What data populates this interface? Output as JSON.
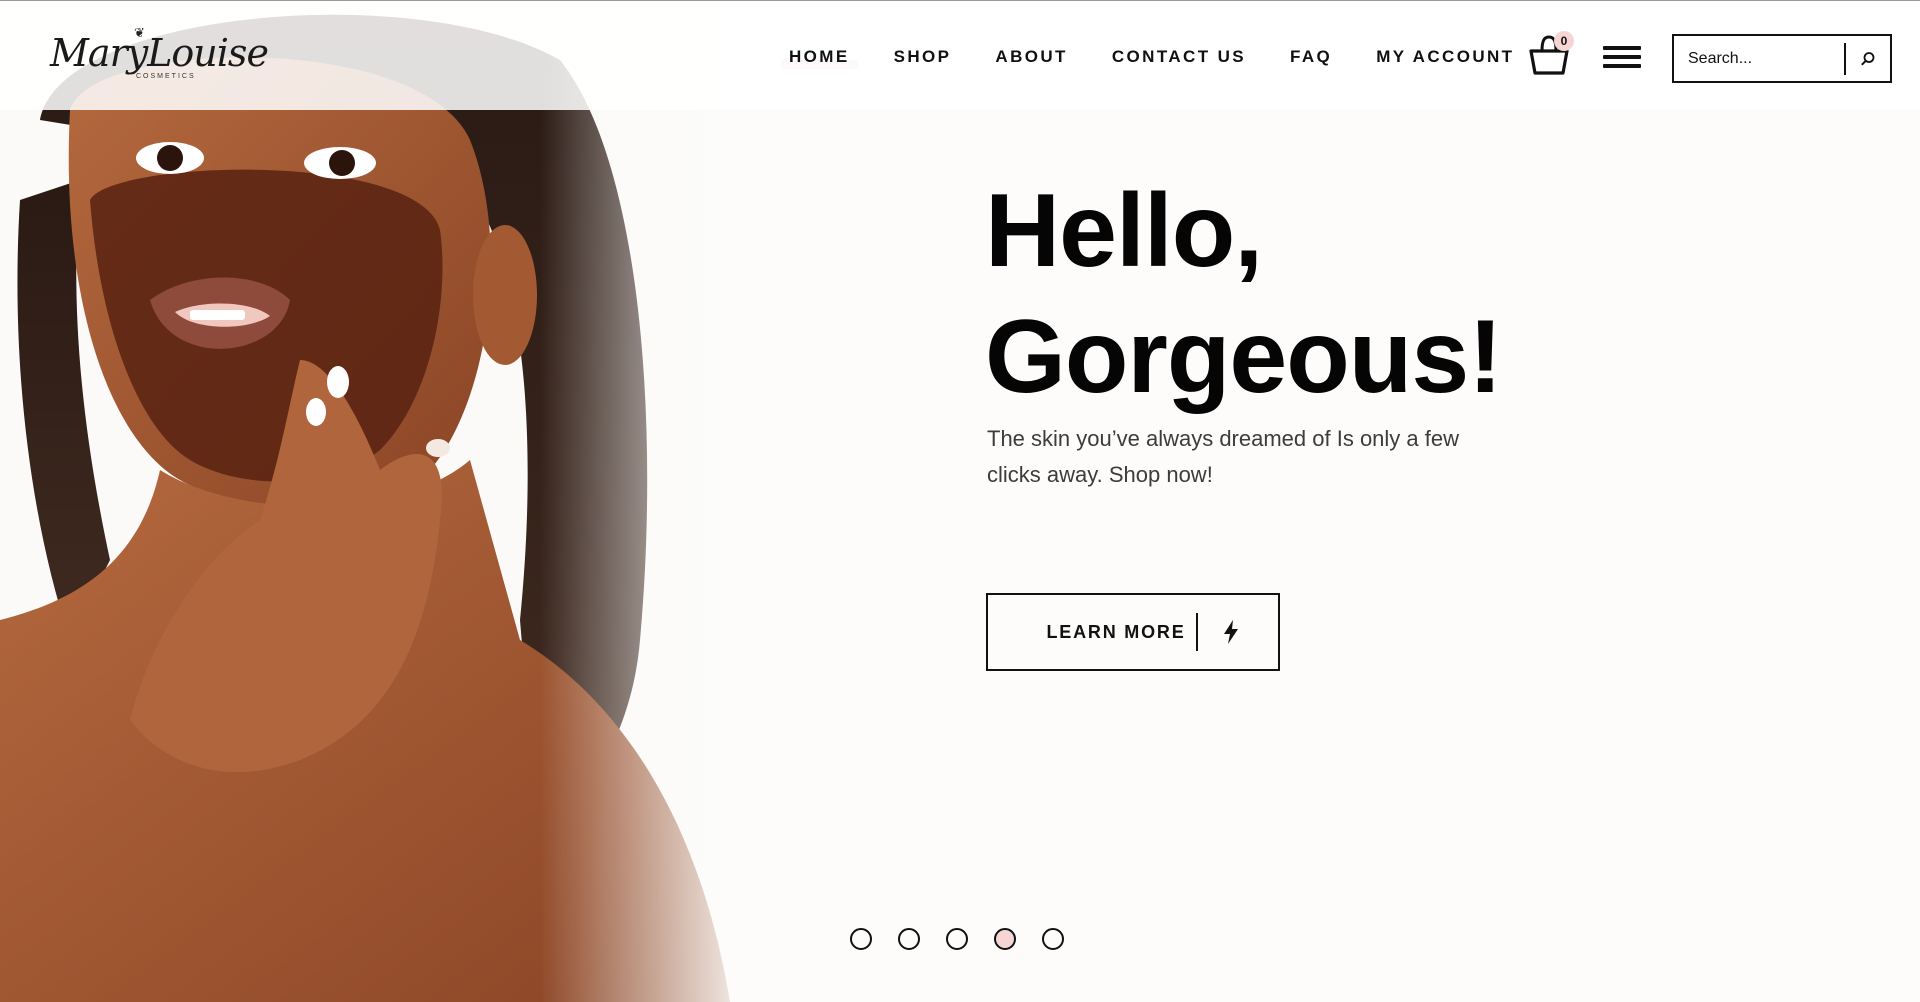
{
  "brand": {
    "name": "MaryLouise",
    "sub": "COSMETICS",
    "accent_color": "#f6d6d4"
  },
  "nav": {
    "items": [
      {
        "label": "HOME",
        "active": true
      },
      {
        "label": "SHOP"
      },
      {
        "label": "ABOUT"
      },
      {
        "label": "CONTACT US"
      },
      {
        "label": "FAQ"
      },
      {
        "label": "MY ACCOUNT"
      }
    ]
  },
  "cart": {
    "icon": "shopping-basket-icon",
    "count": "0"
  },
  "menu": {
    "icon": "hamburger-menu-icon"
  },
  "search": {
    "placeholder": "Search...",
    "icon": "search-icon"
  },
  "hero": {
    "title_line1": "Hello,",
    "title_line2": "Gorgeous!",
    "subtitle": "The skin you’ve always dreamed of Is only a few clicks away. Shop now!",
    "cta_label": "LEARN MORE",
    "cta_icon": "lightning-bolt-icon"
  },
  "slider": {
    "slide_count": 5,
    "active_slide": 4
  }
}
